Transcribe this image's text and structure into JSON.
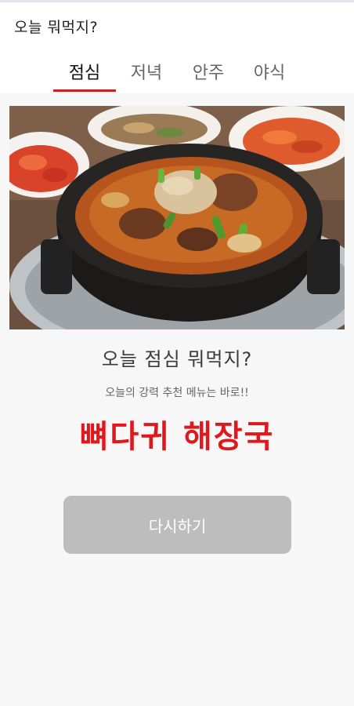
{
  "app_bar": {
    "title": "오늘 뭐먹지?"
  },
  "tabs": [
    {
      "label": "점심",
      "active": true
    },
    {
      "label": "저녁",
      "active": false
    },
    {
      "label": "안주",
      "active": false
    },
    {
      "label": "야식",
      "active": false
    }
  ],
  "main": {
    "headline": "오늘 점심 뭐먹지?",
    "subtitle": "오늘의 강력 추천 메뉴는 바로!!",
    "result": "뼈다귀 해장국",
    "retry_label": "다시하기"
  },
  "colors": {
    "accent": "#d21f1f",
    "result_text": "#e0181e",
    "button_bg": "#bdbdbd"
  }
}
